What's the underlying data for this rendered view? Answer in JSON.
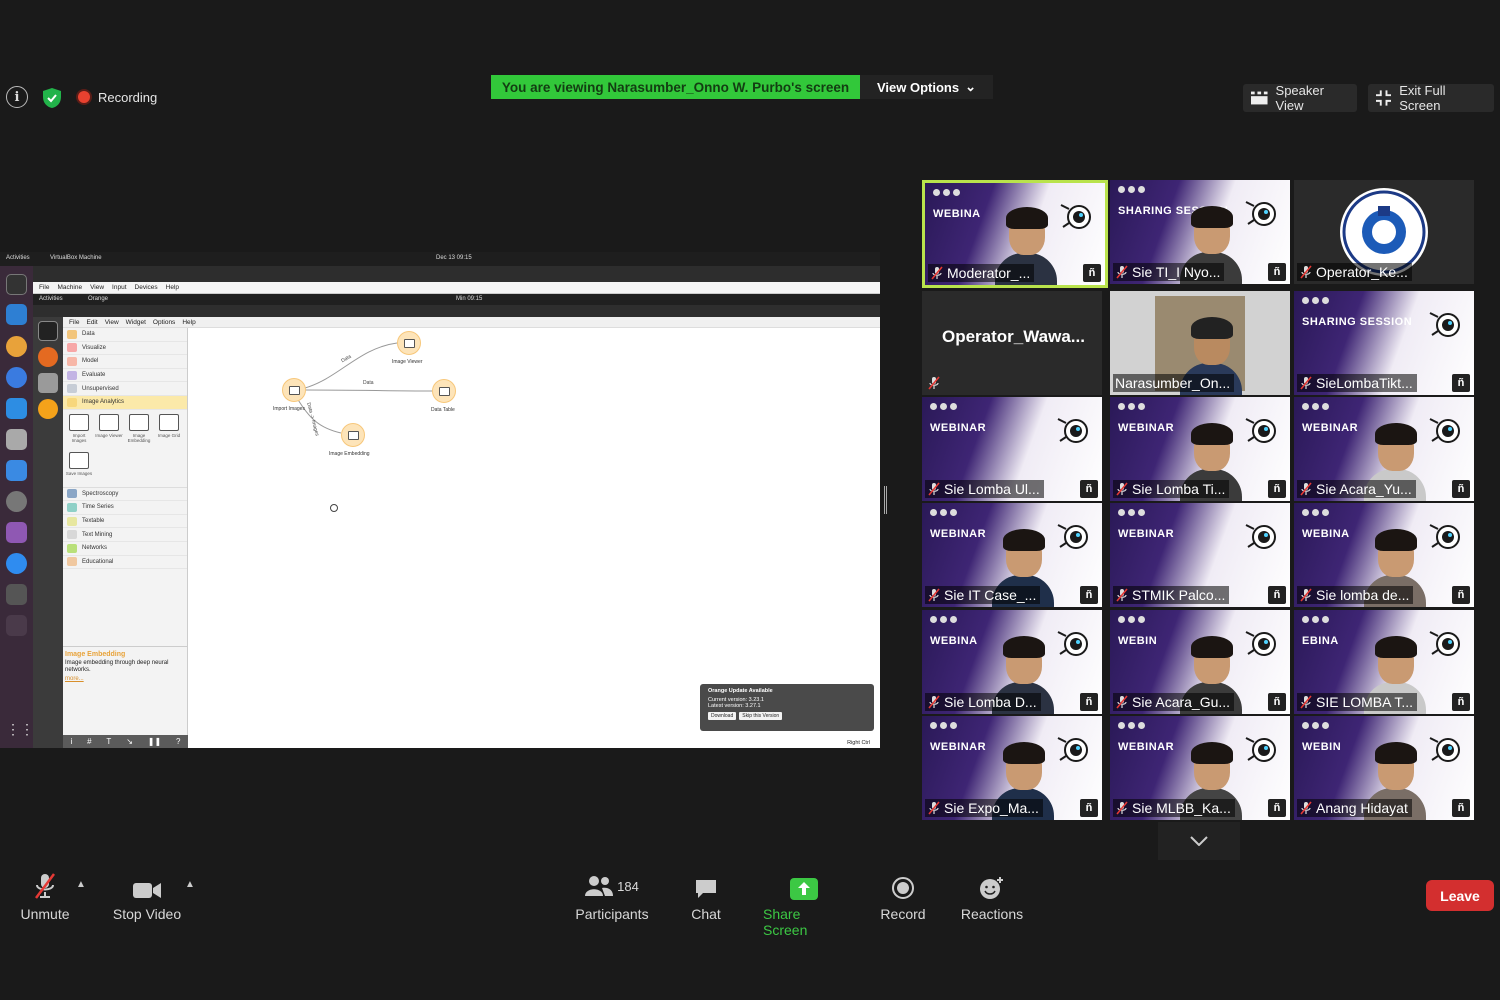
{
  "top": {
    "recording_label": "Recording",
    "viewing_banner": "You are viewing Narasumber_Onno W. Purbo's screen",
    "view_options_label": "View Options",
    "speaker_view_label": "Speaker View",
    "exit_full_screen_label": "Exit Full Screen"
  },
  "shared_screen": {
    "host_activities": "Activities",
    "host_app": "VirtualBox Machine",
    "host_clock": "Dec 13  09:15",
    "vbox_menu": [
      "File",
      "Machine",
      "View",
      "Input",
      "Devices",
      "Help"
    ],
    "guest_activities": "Activities",
    "guest_app": "Orange",
    "guest_clock": "Min 09:15",
    "orange_menu": [
      "File",
      "Edit",
      "View",
      "Widget",
      "Options",
      "Help"
    ],
    "categories": [
      {
        "label": "Data",
        "color": "#f2c57c"
      },
      {
        "label": "Visualize",
        "color": "#f7a7a7"
      },
      {
        "label": "Model",
        "color": "#f7b7a8"
      },
      {
        "label": "Evaluate",
        "color": "#c3b4e4"
      },
      {
        "label": "Unsupervised",
        "color": "#c7cdd6"
      },
      {
        "label": "Image Analytics",
        "color": "#f7d77c"
      }
    ],
    "image_widgets": [
      "Import Images",
      "Image Viewer",
      "Image Embedding",
      "Image Grid",
      "Save Images"
    ],
    "categories_more": [
      {
        "label": "Spectroscopy",
        "color": "#8aa6c6"
      },
      {
        "label": "Time Series",
        "color": "#8fd0c7"
      },
      {
        "label": "Textable",
        "color": "#e7e7a0"
      },
      {
        "label": "Text Mining",
        "color": "#d8d8d8"
      },
      {
        "label": "Networks",
        "color": "#b9e07a"
      },
      {
        "label": "Educational",
        "color": "#f0c8a0"
      }
    ],
    "description_title": "Image Embedding",
    "description_text": "Image embedding through deep neural networks.",
    "description_more": "more...",
    "nodes": {
      "import_images": "Import Images",
      "image_viewer": "Image Viewer",
      "data_table": "Data Table",
      "image_embedding": "Image Embedding"
    },
    "links": {
      "top": "Data",
      "middle": "Data",
      "down": "Data -> Images"
    },
    "update": {
      "title": "Orange Update Available",
      "current": "Current version: 3.23.1",
      "latest": "Latest version: 3.27.1",
      "download": "Download",
      "skip": "Skip this Version"
    },
    "right_ctrl": "Right Ctrl"
  },
  "gallery": [
    {
      "name": "Moderator_...",
      "active": true,
      "kind": "slide_face",
      "slide": "WEBINA",
      "muted": true
    },
    {
      "name": "Sie TI_I Nyo...",
      "kind": "slide_face",
      "slide": "SHARING SESSION",
      "muted": true
    },
    {
      "name": "Operator_Ke...",
      "kind": "logo",
      "muted": true
    },
    {
      "name": "Operator_Wawa...",
      "kind": "name_only",
      "muted": true
    },
    {
      "name": "Narasumber_On...",
      "kind": "face_dark",
      "muted": false
    },
    {
      "name": "SieLombaTikt...",
      "kind": "slide",
      "slide": "SHARING SESSION",
      "muted": true
    },
    {
      "name": "Sie Lomba Ul...",
      "kind": "slide",
      "slide": "WEBINAR",
      "muted": true
    },
    {
      "name": "Sie Lomba Ti...",
      "kind": "slide_face",
      "slide": "WEBINAR",
      "muted": true
    },
    {
      "name": "Sie Acara_Yu...",
      "kind": "slide_face",
      "slide": "WEBINAR",
      "muted": true
    },
    {
      "name": "Sie IT Case_...",
      "kind": "slide_face",
      "slide": "WEBINAR",
      "muted": true
    },
    {
      "name": "STMIK Palco...",
      "kind": "slide",
      "slide": "WEBINAR",
      "muted": true
    },
    {
      "name": "Sie lomba de...",
      "kind": "slide_face",
      "slide": "WEBINA",
      "muted": true
    },
    {
      "name": "Sie Lomba D...",
      "kind": "slide_face",
      "slide": "WEBINA",
      "muted": true
    },
    {
      "name": "Sie Acara_Gu...",
      "kind": "slide_face",
      "slide": "WEBIN",
      "muted": true
    },
    {
      "name": "SIE LOMBA T...",
      "kind": "slide_face",
      "slide": "EBINA",
      "muted": true
    },
    {
      "name": "Sie Expo_Ma...",
      "kind": "slide_face",
      "slide": "WEBINAR",
      "muted": true
    },
    {
      "name": "Sie MLBB_Ka...",
      "kind": "slide_face",
      "slide": "WEBINAR",
      "muted": true
    },
    {
      "name": "Anang Hidayat",
      "kind": "slide_face",
      "slide": "WEBIN",
      "muted": true
    }
  ],
  "toolbar": {
    "unmute_label": "Unmute",
    "stop_video_label": "Stop Video",
    "participants_label": "Participants",
    "participants_count": "184",
    "chat_label": "Chat",
    "share_screen_label": "Share Screen",
    "record_label": "Record",
    "reactions_label": "Reactions",
    "leave_label": "Leave"
  },
  "colors": {
    "banner_green": "#32c83a",
    "share_green": "#3cc844",
    "leave_red": "#d32f2f",
    "active_speaker": "#b9e34c",
    "recording_red": "#e8412f"
  }
}
